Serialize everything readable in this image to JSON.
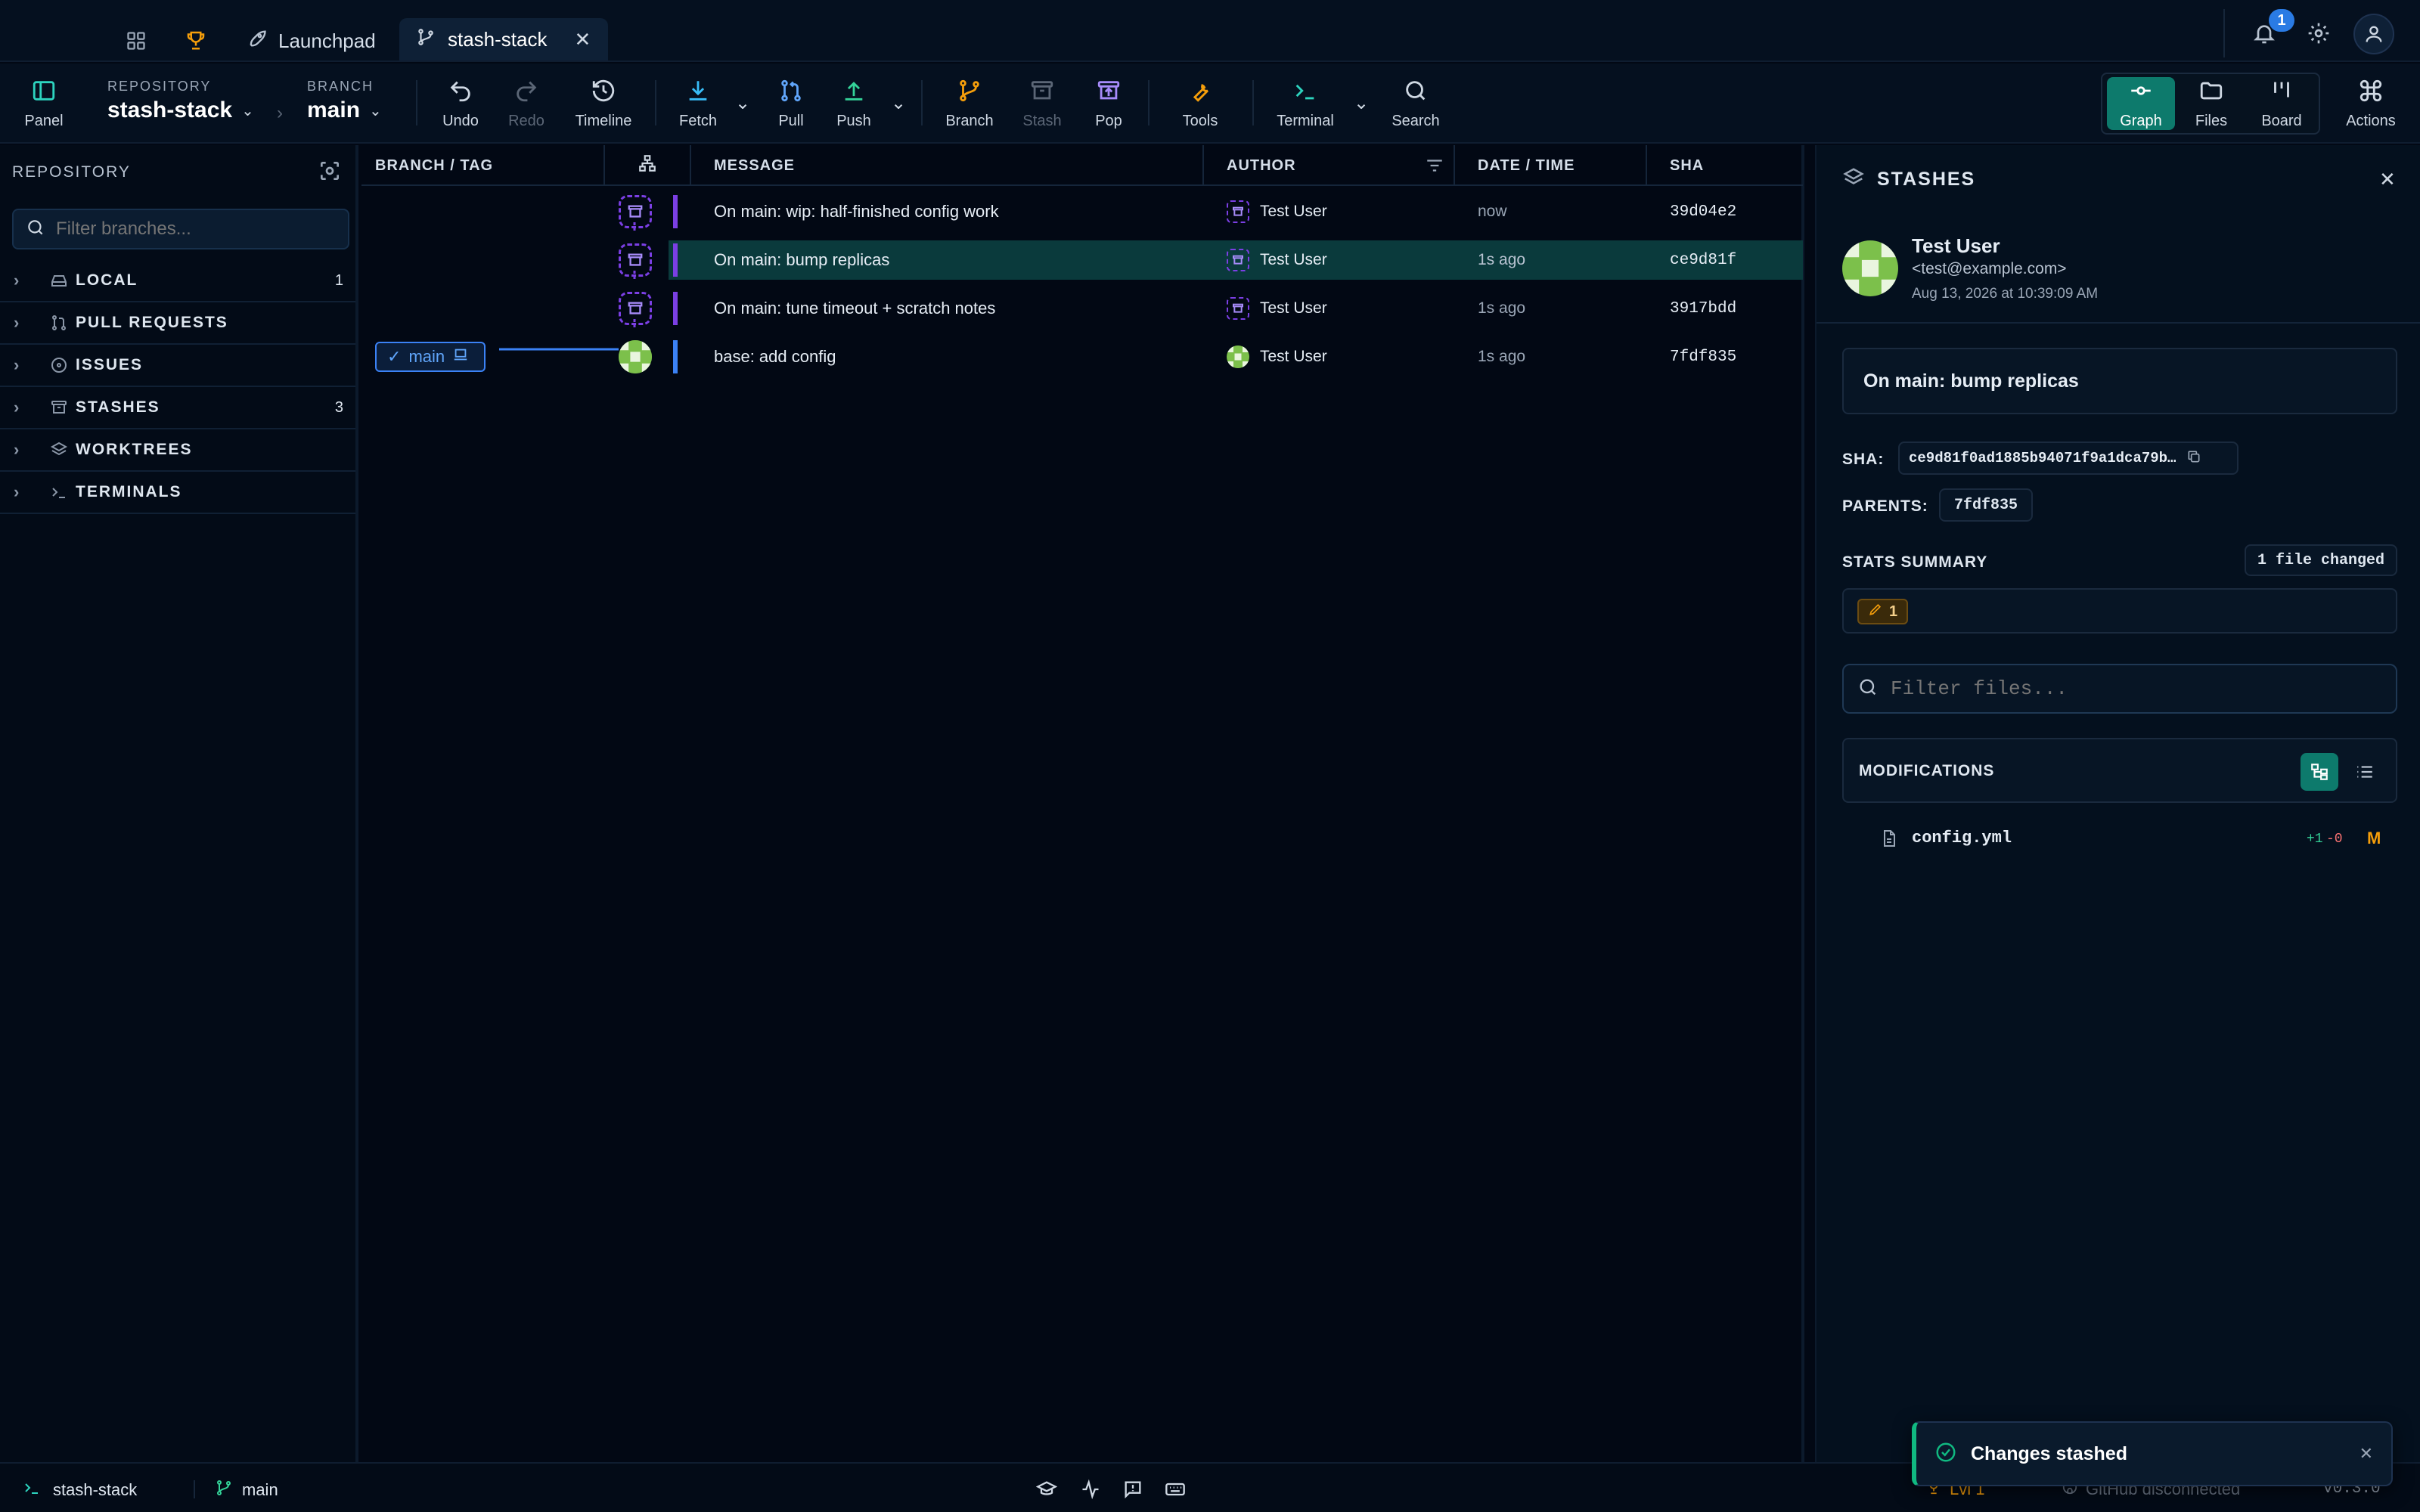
{
  "tabs": {
    "launchpad": "Launchpad",
    "active": "stash-stack",
    "notif_count": "1"
  },
  "toolbar": {
    "panel": "Panel",
    "repo_caption": "REPOSITORY",
    "repo": "stash-stack",
    "branch_caption": "BRANCH",
    "branch": "main",
    "undo": "Undo",
    "redo": "Redo",
    "timeline": "Timeline",
    "fetch": "Fetch",
    "pull": "Pull",
    "push": "Push",
    "branch_btn": "Branch",
    "stash": "Stash",
    "pop": "Pop",
    "tools": "Tools",
    "terminal": "Terminal",
    "search": "Search",
    "graph": "Graph",
    "files": "Files",
    "board": "Board",
    "actions": "Actions"
  },
  "sidebar": {
    "title": "REPOSITORY",
    "filter_placeholder": "Filter branches...",
    "sections": [
      {
        "label": "LOCAL",
        "count": "1",
        "icon": "drive-icon"
      },
      {
        "label": "PULL REQUESTS",
        "count": "",
        "icon": "pull-request-icon"
      },
      {
        "label": "ISSUES",
        "count": "",
        "icon": "issue-icon"
      },
      {
        "label": "STASHES",
        "count": "3",
        "icon": "archive-icon"
      },
      {
        "label": "WORKTREES",
        "count": "",
        "icon": "layers-icon"
      },
      {
        "label": "TERMINALS",
        "count": "",
        "icon": "terminal-icon"
      }
    ]
  },
  "graph": {
    "headers": {
      "branch": "BRANCH / TAG",
      "message": "MESSAGE",
      "author": "AUTHOR",
      "date": "DATE / TIME",
      "sha": "SHA"
    },
    "branch_label": "main",
    "rows": [
      {
        "message": "On main: wip: half-finished config work",
        "author": "Test User",
        "date": "now",
        "sha": "39d04e2"
      },
      {
        "message": "On main: bump replicas",
        "author": "Test User",
        "date": "1s ago",
        "sha": "ce9d81f"
      },
      {
        "message": "On main: tune timeout + scratch notes",
        "author": "Test User",
        "date": "1s ago",
        "sha": "3917bdd"
      },
      {
        "message": "base: add config",
        "author": "Test User",
        "date": "1s ago",
        "sha": "7fdf835"
      }
    ]
  },
  "panel": {
    "title": "STASHES",
    "user": "Test User",
    "email": "<test@example.com>",
    "date": "Aug 13, 2026 at 10:39:09 AM",
    "message": "On main: bump replicas",
    "sha_label": "SHA:",
    "sha": "ce9d81f0ad1885b94071f9a1dca79b…",
    "parents_label": "PARENTS:",
    "parent": "7fdf835",
    "stats_label": "STATS SUMMARY",
    "files_changed": "1 file changed",
    "modified_count": "1",
    "filter_placeholder": "Filter files...",
    "mods_label": "MODIFICATIONS",
    "file": {
      "name": "config.yml",
      "added": "+1",
      "removed": "-0",
      "status": "M"
    }
  },
  "toast": {
    "text": "Changes stashed"
  },
  "status": {
    "terminal": "stash-stack",
    "branch": "main",
    "level": "Lvl 1",
    "github": "GitHub disconnected",
    "version": "v0.3.0"
  },
  "colors": {
    "accent": "#0d7a6c",
    "stash": "#7b3fe4",
    "branch": "#3b82f6"
  }
}
